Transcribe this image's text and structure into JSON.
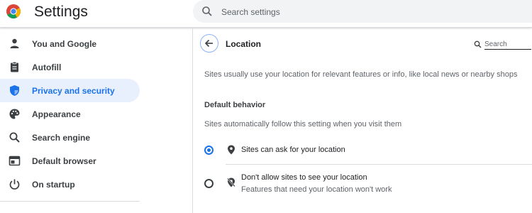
{
  "app": {
    "title": "Settings",
    "search_placeholder": "Search settings"
  },
  "sidebar": {
    "items": [
      {
        "label": "You and Google",
        "icon": "person-icon",
        "active": false
      },
      {
        "label": "Autofill",
        "icon": "clipboard-icon",
        "active": false
      },
      {
        "label": "Privacy and security",
        "icon": "shield-icon",
        "active": true
      },
      {
        "label": "Appearance",
        "icon": "palette-icon",
        "active": false
      },
      {
        "label": "Search engine",
        "icon": "search-icon",
        "active": false
      },
      {
        "label": "Default browser",
        "icon": "browser-icon",
        "active": false
      },
      {
        "label": "On startup",
        "icon": "power-icon",
        "active": false
      }
    ]
  },
  "page": {
    "title": "Location",
    "search_placeholder": "Search",
    "description": "Sites usually use your location for relevant features or info, like local news or nearby shops",
    "default_behavior": {
      "heading": "Default behavior",
      "description": "Sites automatically follow this setting when you visit them",
      "options": [
        {
          "label": "Sites can ask for your location",
          "sublabel": "",
          "selected": true,
          "icon": "location-pin-icon"
        },
        {
          "label": "Don't allow sites to see your location",
          "sublabel": "Features that need your location won't work",
          "selected": false,
          "icon": "location-off-icon"
        }
      ]
    }
  },
  "colors": {
    "accent": "#1a73e8",
    "active_bg": "#e8f0fe",
    "text": "#202124",
    "secondary_text": "#5f6368"
  }
}
